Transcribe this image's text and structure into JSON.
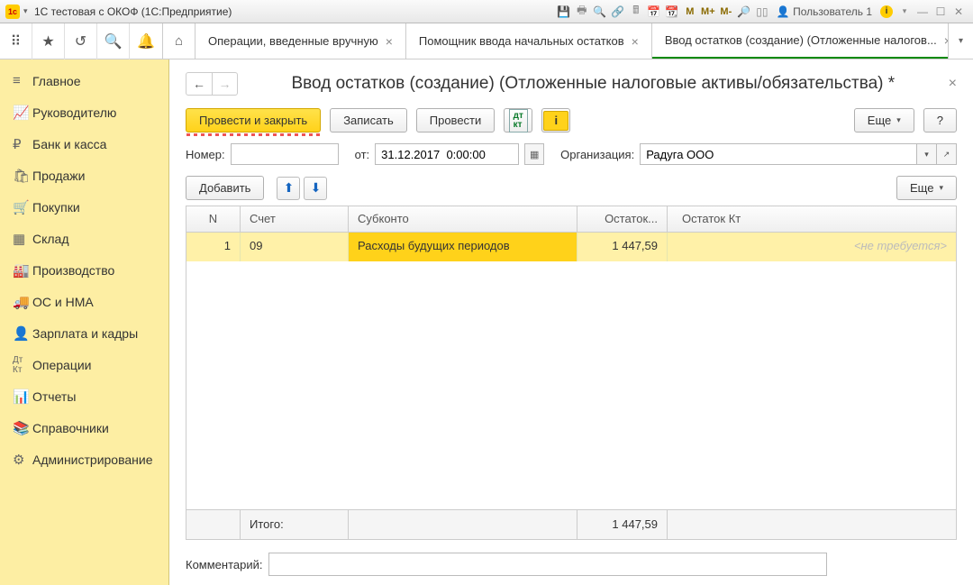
{
  "titlebar": {
    "title": "1С тестовая с ОКОФ  (1С:Предприятие)",
    "user": "Пользователь 1"
  },
  "tabs": [
    {
      "label": "Операции, введенные вручную"
    },
    {
      "label": "Помощник ввода начальных остатков"
    },
    {
      "label": "Ввод остатков (создание) (Отложенные налогов..."
    }
  ],
  "sidebar": {
    "items": [
      {
        "label": "Главное"
      },
      {
        "label": "Руководителю"
      },
      {
        "label": "Банк и касса"
      },
      {
        "label": "Продажи"
      },
      {
        "label": "Покупки"
      },
      {
        "label": "Склад"
      },
      {
        "label": "Производство"
      },
      {
        "label": "ОС и НМА"
      },
      {
        "label": "Зарплата и кадры"
      },
      {
        "label": "Операции"
      },
      {
        "label": "Отчеты"
      },
      {
        "label": "Справочники"
      },
      {
        "label": "Администрирование"
      }
    ]
  },
  "heading": "Ввод остатков (создание) (Отложенные налоговые активы/обязательства) *",
  "actions": {
    "post_close": "Провести и закрыть",
    "save": "Записать",
    "post": "Провести",
    "more": "Еще",
    "help": "?"
  },
  "fields": {
    "number_label": "Номер:",
    "number_value": "",
    "from_label": "от:",
    "date_value": "31.12.2017  0:00:00",
    "org_label": "Организация:",
    "org_value": "Радуга ООО"
  },
  "table_toolbar": {
    "add": "Добавить",
    "more": "Еще"
  },
  "table": {
    "headers": {
      "n": "N",
      "schet": "Счет",
      "sub": "Субконто",
      "dt": "Остаток...",
      "kt": "Остаток Кт"
    },
    "rows": [
      {
        "n": "1",
        "schet": "09",
        "sub": "Расходы будущих периодов",
        "dt": "1 447,59",
        "kt": "<не требуется>"
      }
    ],
    "footer": {
      "label": "Итого:",
      "dt": "1 447,59"
    }
  },
  "comment": {
    "label": "Комментарий:",
    "value": ""
  }
}
